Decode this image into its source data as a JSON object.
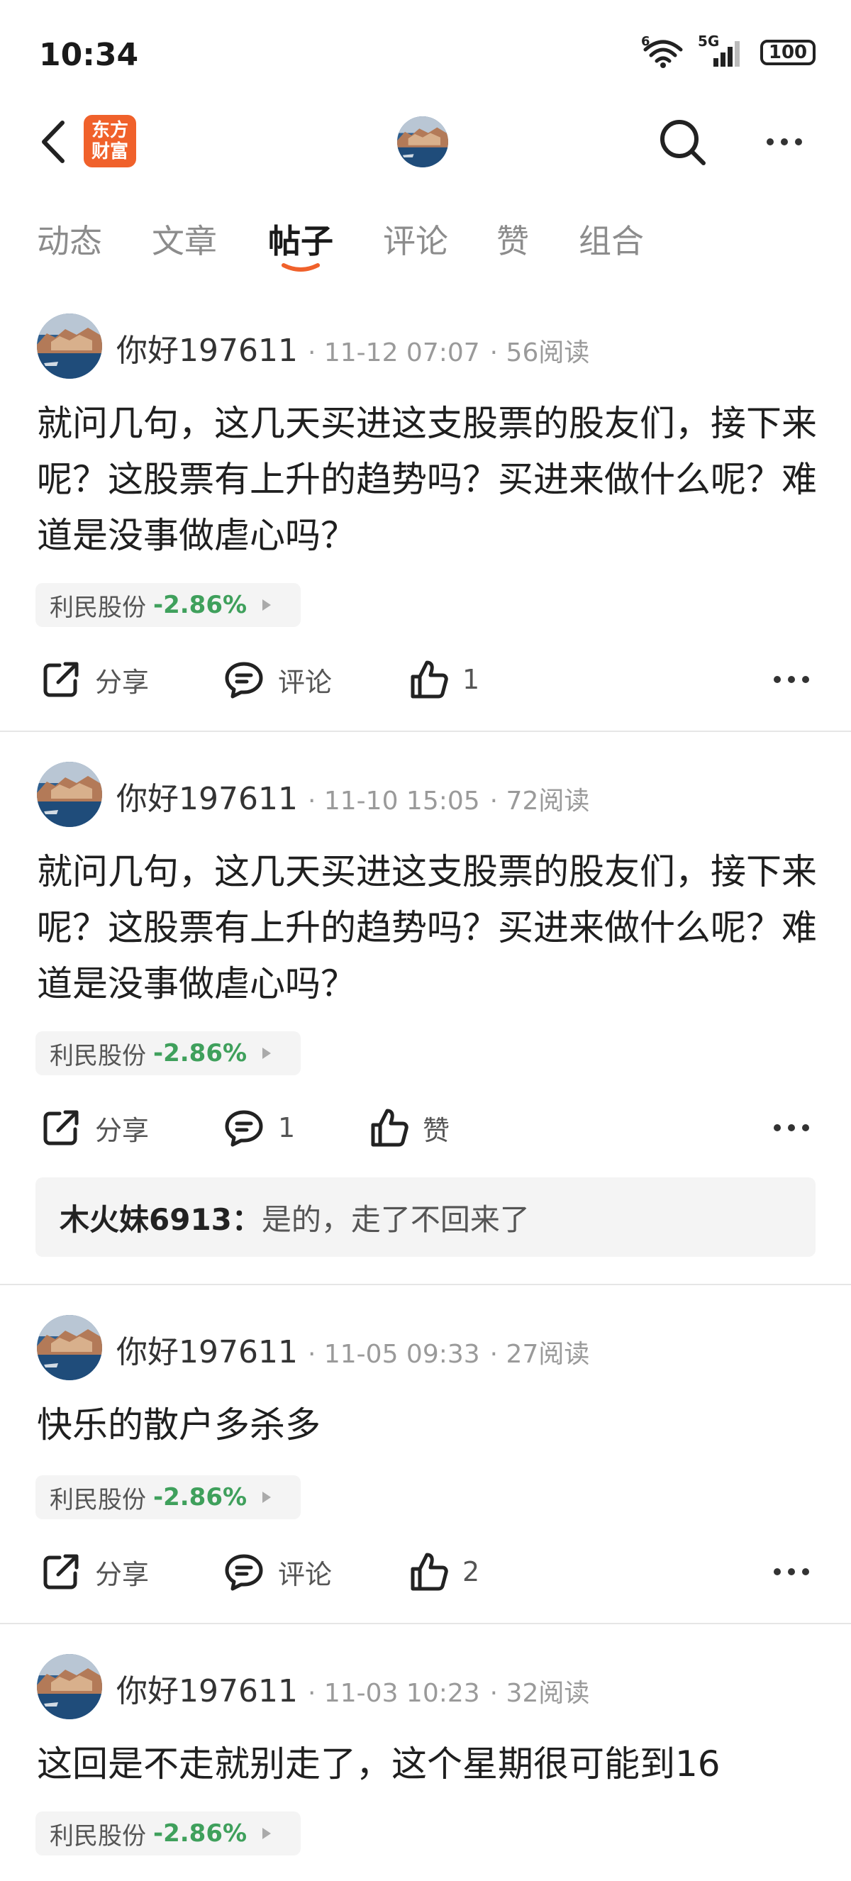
{
  "status_bar": {
    "time": "10:34",
    "network": "5G",
    "wifi_badge": "6",
    "battery": "100"
  },
  "nav": {
    "logo_text": "东方财富"
  },
  "tabs": [
    {
      "label": "动态",
      "active": false
    },
    {
      "label": "文章",
      "active": false
    },
    {
      "label": "帖子",
      "active": true
    },
    {
      "label": "评论",
      "active": false
    },
    {
      "label": "赞",
      "active": false
    },
    {
      "label": "组合",
      "active": false
    }
  ],
  "colors": {
    "accent": "#f0612b",
    "stock_down": "#3fa05c"
  },
  "posts": [
    {
      "author": "你好197611",
      "date": "11-12 07:07",
      "reads": "56阅读",
      "content": "就问几句，这几天买进这支股票的股友们，接下来呢？这股票有上升的趋势吗？买进来做什么呢？难道是没事做虐心吗？",
      "stock": {
        "name": "利民股份",
        "change": "-2.86%"
      },
      "share_label": "分享",
      "comment_label": "评论",
      "like_label": "1"
    },
    {
      "author": "你好197611",
      "date": "11-10 15:05",
      "reads": "72阅读",
      "content": "就问几句，这几天买进这支股票的股友们，接下来呢？这股票有上升的趋势吗？买进来做什么呢？难道是没事做虐心吗？",
      "stock": {
        "name": "利民股份",
        "change": "-2.86%"
      },
      "share_label": "分享",
      "comment_label": "1",
      "like_label": "赞",
      "reply": {
        "author": "木火妹6913：",
        "text": "是的，走了不回来了"
      }
    },
    {
      "author": "你好197611",
      "date": "11-05 09:33",
      "reads": "27阅读",
      "content": "快乐的散户多杀多",
      "stock": {
        "name": "利民股份",
        "change": "-2.86%"
      },
      "share_label": "分享",
      "comment_label": "评论",
      "like_label": "2"
    },
    {
      "author": "你好197611",
      "date": "11-03 10:23",
      "reads": "32阅读",
      "content": "这回是不走就别走了，这个星期很可能到16",
      "stock": {
        "name": "利民股份",
        "change": "-2.86%"
      }
    }
  ]
}
